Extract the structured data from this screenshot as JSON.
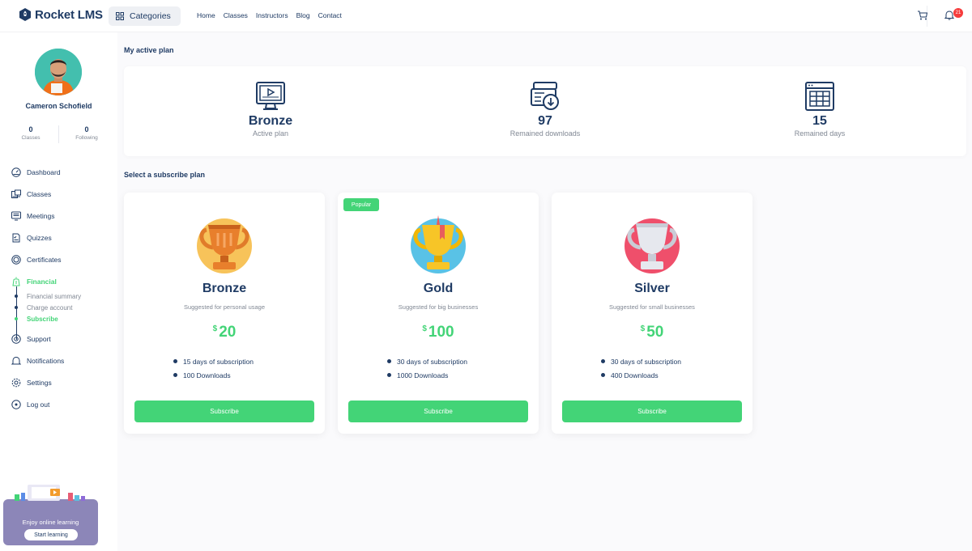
{
  "brand": {
    "name": "Rocket LMS"
  },
  "header": {
    "categories_label": "Categories",
    "nav": [
      "Home",
      "Classes",
      "Instructors",
      "Blog",
      "Contact"
    ],
    "notification_count": "21"
  },
  "user": {
    "name": "Cameron Schofield",
    "stats": [
      {
        "value": "0",
        "label": "Classes"
      },
      {
        "value": "0",
        "label": "Following"
      }
    ]
  },
  "sidebar": {
    "items": [
      {
        "label": "Dashboard",
        "icon": "dashboard-icon"
      },
      {
        "label": "Classes",
        "icon": "classes-icon"
      },
      {
        "label": "Meetings",
        "icon": "meetings-icon"
      },
      {
        "label": "Quizzes",
        "icon": "quizzes-icon"
      },
      {
        "label": "Certificates",
        "icon": "certificate-icon"
      },
      {
        "label": "Financial",
        "icon": "financial-icon"
      },
      {
        "label": "Support",
        "icon": "support-icon"
      },
      {
        "label": "Notifications",
        "icon": "bell-icon"
      },
      {
        "label": "Settings",
        "icon": "gear-icon"
      },
      {
        "label": "Log out",
        "icon": "logout-icon"
      }
    ],
    "financial_sub": [
      "Financial summary",
      "Charge account",
      "Subscribe"
    ],
    "promo": {
      "text": "Enjoy online learning",
      "button": "Start learning"
    }
  },
  "active_plan": {
    "title": "My active plan",
    "items": [
      {
        "value": "Bronze",
        "label": "Active plan",
        "icon": "monitor-icon"
      },
      {
        "value": "97",
        "label": "Remained downloads",
        "icon": "download-icon"
      },
      {
        "value": "15",
        "label": "Remained days",
        "icon": "calendar-icon"
      }
    ]
  },
  "plans": {
    "title": "Select a subscribe plan",
    "popular_label": "Popular",
    "subscribe_label": "Subscribe",
    "currency": "$",
    "cards": [
      {
        "name": "Bronze",
        "desc": "Suggested for personal usage",
        "price": "20",
        "features": [
          "15 days of subscription",
          "100 Downloads"
        ]
      },
      {
        "name": "Gold",
        "desc": "Suggested for big businesses",
        "price": "100",
        "features": [
          "30 days of subscription",
          "1000 Downloads"
        ]
      },
      {
        "name": "Silver",
        "desc": "Suggested for small businesses",
        "price": "50",
        "features": [
          "30 days of subscription",
          "400 Downloads"
        ]
      }
    ]
  },
  "colors": {
    "primary": "#43d477",
    "text": "#1f3b64",
    "muted": "#818894",
    "badge": "#f63c3c"
  }
}
